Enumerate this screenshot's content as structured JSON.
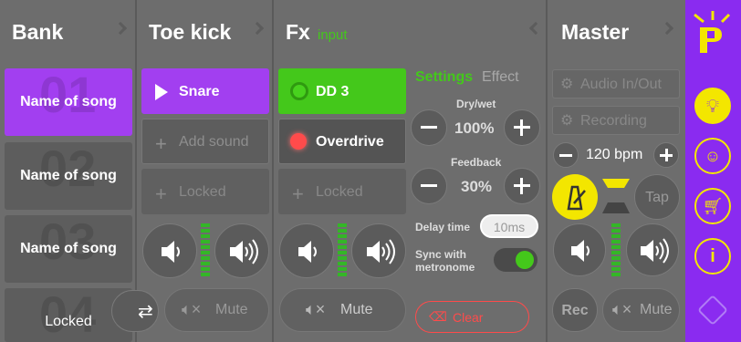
{
  "columns": {
    "bank": {
      "title": "Bank",
      "slots": [
        {
          "number": "01",
          "label": "Name of song"
        },
        {
          "number": "02",
          "label": "Name of song"
        },
        {
          "number": "03",
          "label": "Name of song"
        },
        {
          "number": "04",
          "label": "Locked"
        }
      ]
    },
    "toe_kick": {
      "title": "Toe kick",
      "play_label": "Snare",
      "add_label": "Add sound",
      "locked_label": "Locked",
      "mute_label": "Mute"
    },
    "fx": {
      "title": "Fx",
      "subtitle": "input",
      "items": [
        {
          "label": "DD 3"
        },
        {
          "label": "Overdrive"
        },
        {
          "label": "Locked"
        }
      ],
      "tabs": {
        "settings": "Settings",
        "effect": "Effect"
      },
      "dry_wet": {
        "label": "Dry/wet",
        "value": "100%"
      },
      "feedback": {
        "label": "Feedback",
        "value": "30%"
      },
      "delay": {
        "label": "Delay time",
        "value": "10ms"
      },
      "sync": {
        "label": "Sync with metronome",
        "on": true
      },
      "clear_label": "Clear",
      "mute_label": "Mute"
    },
    "master": {
      "title": "Master",
      "audio_label": "Audio In/Out",
      "recording_label": "Recording",
      "bpm": "120 bpm",
      "tap_label": "Tap",
      "rec_label": "Rec",
      "mute_label": "Mute"
    }
  },
  "colors": {
    "purple": "#a23ff0",
    "green": "#44c81b",
    "yellow": "#f3e600",
    "red": "#ff4b4b"
  }
}
